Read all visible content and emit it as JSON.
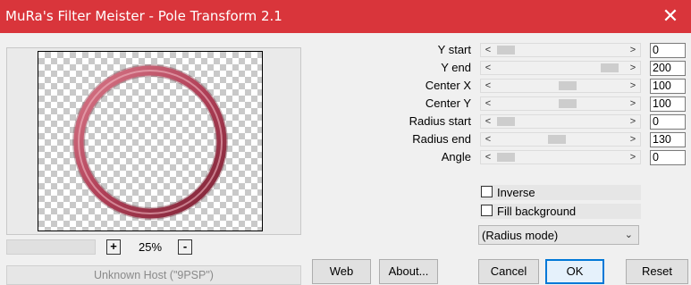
{
  "window": {
    "title": "MuRa's Filter Meister - Pole Transform 2.1",
    "close_glyph": "✕"
  },
  "preview": {
    "ring_color": "#b9455b"
  },
  "zoom": {
    "minus": "-",
    "plus": "+",
    "value": "25%"
  },
  "host": {
    "text": "Unknown Host (\"9PSP\")"
  },
  "sliders": [
    {
      "label": "Y start",
      "value": "0",
      "position": 0.0
    },
    {
      "label": "Y end",
      "value": "200",
      "position": 0.92
    },
    {
      "label": "Center X",
      "value": "100",
      "position": 0.55
    },
    {
      "label": "Center Y",
      "value": "100",
      "position": 0.55
    },
    {
      "label": "Radius start",
      "value": "0",
      "position": 0.0
    },
    {
      "label": "Radius end",
      "value": "130",
      "position": 0.45
    },
    {
      "label": "Angle",
      "value": "0",
      "position": 0.0
    }
  ],
  "arrows": {
    "left": "<",
    "right": ">"
  },
  "checkboxes": {
    "inverse": {
      "label": "Inverse",
      "checked": false
    },
    "fill_background": {
      "label": "Fill background",
      "checked": false
    }
  },
  "mode_select": {
    "selected": "(Radius mode)",
    "chevron": "⌄"
  },
  "buttons": {
    "web": "Web",
    "about": "About...",
    "cancel": "Cancel",
    "ok": "OK",
    "reset": "Reset"
  }
}
